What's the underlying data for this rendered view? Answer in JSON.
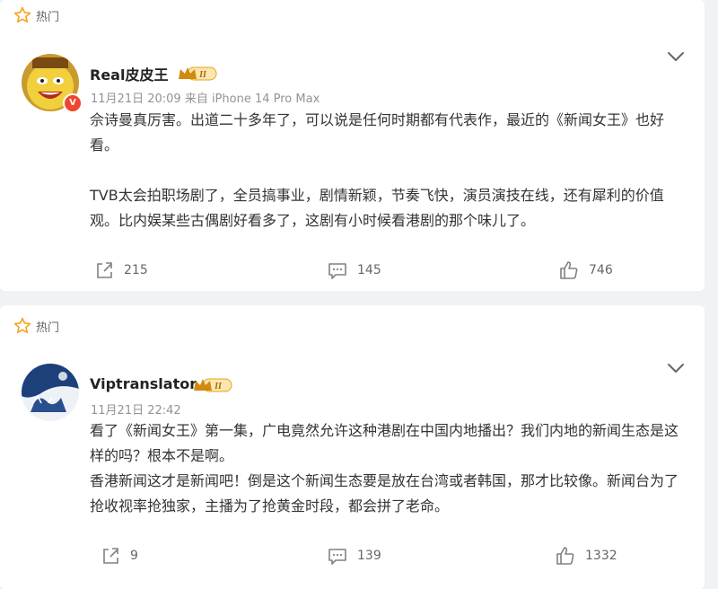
{
  "comments": [
    {
      "hot_label": "热门",
      "username": "Real皮皮王",
      "badge_level": "II",
      "meta": "11月21日 20:09  来自 iPhone 14 Pro Max",
      "paragraphs": [
        "佘诗曼真厉害。出道二十多年了，可以说是任何时期都有代表作，最近的《新闻女王》也好看。",
        "TVB太会拍职场剧了，全员搞事业，剧情新颖，节奏飞快，演员演技在线，还有犀利的价值观。比内娱某些古偶剧好看多了，这剧有小时候看港剧的那个味儿了。"
      ],
      "reposts": "215",
      "comment_count": "145",
      "likes": "746",
      "verified": "V"
    },
    {
      "hot_label": "热门",
      "username": "Viptranslator",
      "badge_level": "II",
      "meta": "11月21日 22:42",
      "paragraphs": [
        "看了《新闻女王》第一集，广电竟然允许这种港剧在中国内地播出？我们内地的新闻生态是这样的吗？根本不是啊。",
        "香港新闻这才是新闻吧！倒是这个新闻生态要是放在台湾或者韩国，那才比较像。新闻台为了抢收视率抢独家，主播为了抢黄金时段，都会拼了老命。"
      ],
      "reposts": "9",
      "comment_count": "139",
      "likes": "1332"
    }
  ],
  "colors": {
    "hot_star": "#f5a623",
    "badge_gold": "#e8a317",
    "verified_red": "#f0462e",
    "icon_gray": "#808080"
  },
  "icons": {
    "hot": "star-outline-icon",
    "repost": "share-out-icon",
    "comment": "comment-bubble-icon",
    "like": "thumbs-up-icon",
    "more": "chevron-down-icon"
  }
}
